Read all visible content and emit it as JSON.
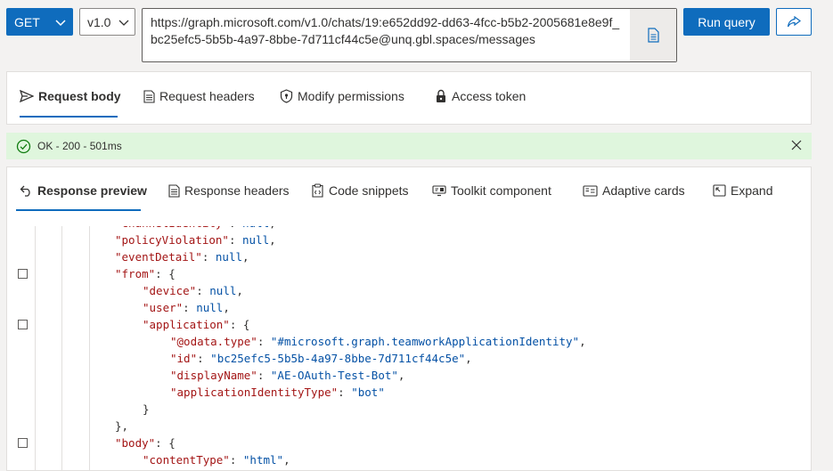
{
  "toolbar": {
    "method": "GET",
    "version": "v1.0",
    "url": "https://graph.microsoft.com/v1.0/chats/19:e652dd92-dd63-4fcc-b5b2-2005681e8e9f_bc25efc5-5b5b-4a97-8bbe-7d711cf44c5e@unq.gbl.spaces/messages",
    "run_label": "Run query",
    "icons": {
      "method_chevron": "chevron-down-icon",
      "version_chevron": "chevron-down-icon",
      "doc": "document-icon",
      "share": "share-icon"
    }
  },
  "request_tabs": [
    {
      "label": "Request body",
      "icon": "send-icon",
      "active": true
    },
    {
      "label": "Request headers",
      "icon": "document-list-icon",
      "active": false
    },
    {
      "label": "Modify permissions",
      "icon": "shield-icon",
      "active": false
    },
    {
      "label": "Access token",
      "icon": "lock-icon",
      "active": false
    }
  ],
  "status": {
    "text": "OK - 200 - 501ms",
    "icon": "check-circle-icon",
    "close_icon": "close-icon"
  },
  "response_tabs": [
    {
      "label": "Response preview",
      "icon": "undo-arrow-icon",
      "active": true
    },
    {
      "label": "Response headers",
      "icon": "document-list-icon",
      "active": false
    },
    {
      "label": "Code snippets",
      "icon": "clipboard-code-icon",
      "active": false
    },
    {
      "label": "Toolkit component",
      "icon": "toolkit-icon",
      "active": false
    },
    {
      "label": "Adaptive cards",
      "icon": "card-icon",
      "active": false
    },
    {
      "label": "Expand",
      "icon": "expand-icon",
      "active": false
    }
  ],
  "code_lines": [
    {
      "key": "\"channelIdentity\"",
      "sep": ": ",
      "val": "null",
      "vtype": "null",
      "tail": ",",
      "indent": 3,
      "cb": false,
      "partial": true
    },
    {
      "key": "\"policyViolation\"",
      "sep": ": ",
      "val": "null",
      "vtype": "null",
      "tail": ",",
      "indent": 3,
      "cb": false
    },
    {
      "key": "\"eventDetail\"",
      "sep": ": ",
      "val": "null",
      "vtype": "null",
      "tail": ",",
      "indent": 3,
      "cb": false
    },
    {
      "key": "\"from\"",
      "sep": ": ",
      "val": "{",
      "vtype": "punct",
      "tail": "",
      "indent": 3,
      "cb": true
    },
    {
      "key": "\"device\"",
      "sep": ": ",
      "val": "null",
      "vtype": "null",
      "tail": ",",
      "indent": 4,
      "cb": false
    },
    {
      "key": "\"user\"",
      "sep": ": ",
      "val": "null",
      "vtype": "null",
      "tail": ",",
      "indent": 4,
      "cb": false
    },
    {
      "key": "\"application\"",
      "sep": ": ",
      "val": "{",
      "vtype": "punct",
      "tail": "",
      "indent": 4,
      "cb": true
    },
    {
      "key": "\"@odata.type\"",
      "sep": ": ",
      "val": "\"#microsoft.graph.teamworkApplicationIdentity\"",
      "vtype": "str",
      "tail": ",",
      "indent": 5,
      "cb": false
    },
    {
      "key": "\"id\"",
      "sep": ": ",
      "val": "\"bc25efc5-5b5b-4a97-8bbe-7d711cf44c5e\"",
      "vtype": "str",
      "tail": ",",
      "indent": 5,
      "cb": false
    },
    {
      "key": "\"displayName\"",
      "sep": ": ",
      "val": "\"AE-OAuth-Test-Bot\"",
      "vtype": "str",
      "tail": ",",
      "indent": 5,
      "cb": false
    },
    {
      "key": "\"applicationIdentityType\"",
      "sep": ": ",
      "val": "\"bot\"",
      "vtype": "str",
      "tail": "",
      "indent": 5,
      "cb": false
    },
    {
      "key": "",
      "sep": "",
      "val": "}",
      "vtype": "punct",
      "tail": "",
      "indent": 4,
      "cb": false
    },
    {
      "key": "",
      "sep": "",
      "val": "}",
      "vtype": "punct",
      "tail": ",",
      "indent": 3,
      "cb": false
    },
    {
      "key": "\"body\"",
      "sep": ": ",
      "val": "{",
      "vtype": "punct",
      "tail": "",
      "indent": 3,
      "cb": true
    },
    {
      "key": "\"contentType\"",
      "sep": ": ",
      "val": "\"html\"",
      "vtype": "str",
      "tail": ",",
      "indent": 4,
      "cb": false
    }
  ]
}
